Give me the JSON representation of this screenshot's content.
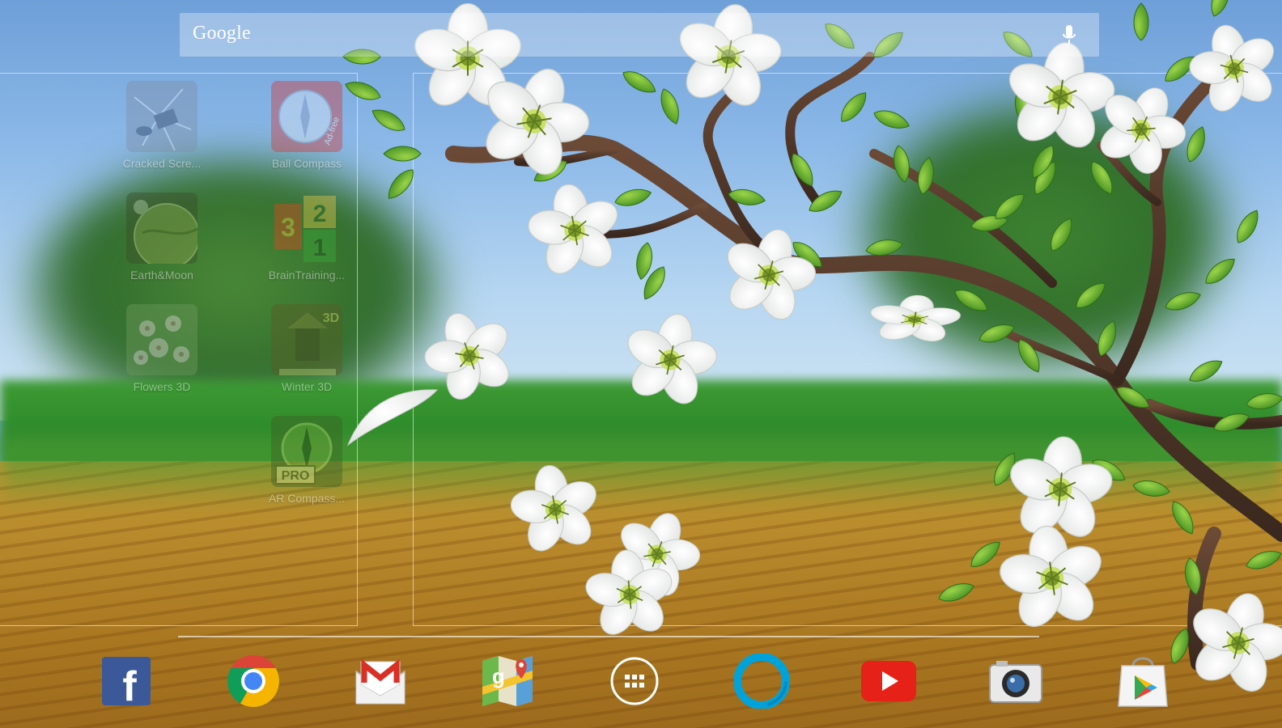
{
  "search": {
    "label": "Google",
    "mic_icon": "microphone-icon"
  },
  "apps": [
    {
      "label": "Cracked Scre...",
      "icon": "cracked-screen-icon"
    },
    {
      "label": "Ball Compass",
      "icon": "ball-compass-icon",
      "badge": "Ad-free"
    },
    {
      "label": "Earth&Moon",
      "icon": "earth-moon-icon"
    },
    {
      "label": "BrainTraining...",
      "icon": "brain-training-icon",
      "digits": [
        "3",
        "2",
        "1"
      ]
    },
    {
      "label": "Flowers 3D",
      "icon": "flowers-3d-icon"
    },
    {
      "label": "Winter 3D",
      "icon": "winter-3d-icon",
      "badge": "3D"
    },
    {
      "label": "AR Compass...",
      "icon": "ar-compass-icon",
      "badge": "PRO"
    }
  ],
  "dock": [
    {
      "name": "facebook-icon",
      "glyph": "f"
    },
    {
      "name": "chrome-icon"
    },
    {
      "name": "gmail-icon",
      "glyph": "M"
    },
    {
      "name": "maps-icon",
      "glyph": "g"
    },
    {
      "name": "all-apps-icon"
    },
    {
      "name": "google-plus-photos-icon"
    },
    {
      "name": "youtube-icon"
    },
    {
      "name": "camera-icon"
    },
    {
      "name": "play-store-icon"
    }
  ],
  "colors": {
    "facebook": "#3b5998",
    "youtube": "#e62117",
    "chrome_red": "#db4437",
    "chrome_yellow": "#f4b400",
    "chrome_green": "#0f9d58",
    "chrome_blue": "#4285f4"
  }
}
